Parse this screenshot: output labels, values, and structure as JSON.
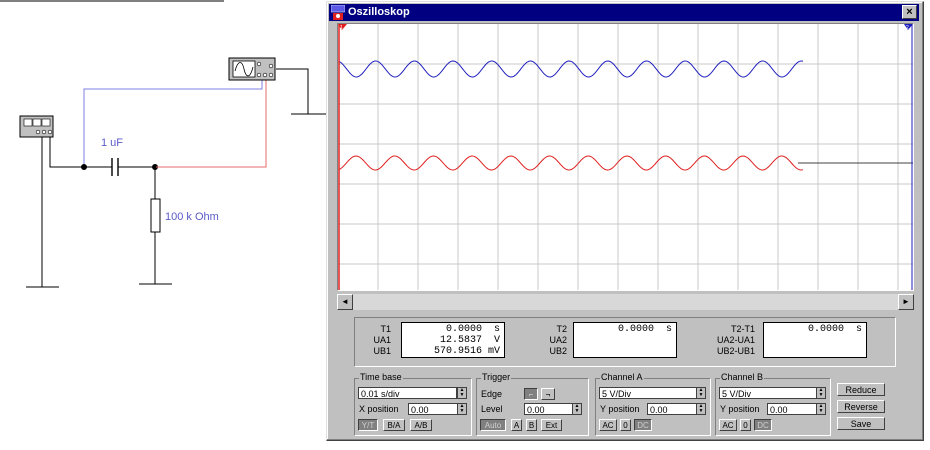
{
  "schematic": {
    "capacitor_label": "1 uF",
    "resistor_label": "100 k Ohm"
  },
  "window": {
    "title": "Oszilloskop",
    "close_glyph": "×"
  },
  "screen": {
    "grid_color": "#c8c8c8",
    "channel_a_color": "#1e1ebe",
    "channel_b_color": "#e01e1e",
    "cursor1_color": "#e01e1e",
    "cursor2_color": "#1e1ebe",
    "cursor1_label": "1",
    "cursor2_label": "2"
  },
  "scroll": {
    "left": "◄",
    "right": "►"
  },
  "readout": {
    "t1_label": "T1",
    "ua1_label": "UA1",
    "ub1_label": "UB1",
    "t1": "0.0000  s",
    "ua1": "12.5837  V",
    "ub1": "570.9516 mV",
    "t2_label": "T2",
    "ua2_label": "UA2",
    "ub2_label": "UB2",
    "t2": "0.0000  s",
    "t21_label": "T2-T1",
    "ua21_label": "UA2-UA1",
    "ub21_label": "UB2-UB1",
    "t21": "0.0000  s"
  },
  "timebase": {
    "title": "Time base",
    "value": "0.01 s/div",
    "xpos_label": "X position",
    "xpos": "0.00",
    "yt": "Y/T",
    "ba": "B/A",
    "ab": "A/B"
  },
  "trigger": {
    "title": "Trigger",
    "edge_label": "Edge",
    "rising": "⌐",
    "falling": "¬",
    "level_label": "Level",
    "level": "0.00",
    "auto": "Auto",
    "a": "A",
    "b": "B",
    "ext": "Ext"
  },
  "channel_a": {
    "title": "Channel A",
    "value": "5  V/Div",
    "ypos_label": "Y position",
    "ypos": "0.00",
    "ac": "AC",
    "zero": "0",
    "dc": "DC"
  },
  "channel_b": {
    "title": "Channel B",
    "value": "5  V/Div",
    "ypos_label": "Y position",
    "ypos": "0.00",
    "ac": "AC",
    "zero": "0",
    "dc": "DC"
  },
  "actions": {
    "reduce": "Reduce",
    "reverse": "Reverse",
    "save": "Save"
  }
}
